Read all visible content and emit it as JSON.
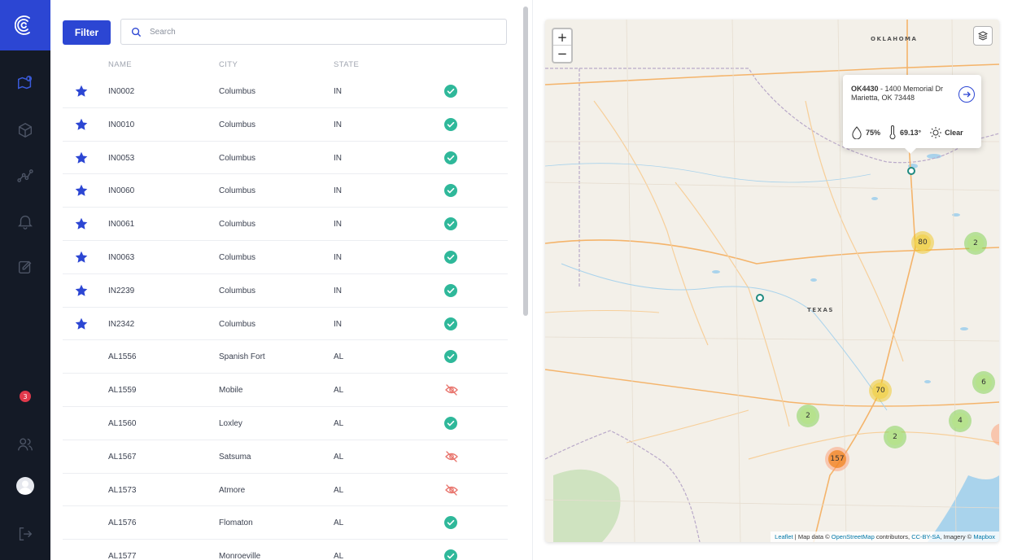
{
  "sidebar": {
    "badge_count": "3",
    "nav": [
      "logo-icon",
      "map-pin-icon",
      "cube-icon",
      "analytics-icon",
      "bell-icon",
      "clipboard-icon",
      "users-icon",
      "logout-icon"
    ]
  },
  "toolbar": {
    "filter_label": "Filter",
    "search_placeholder": "Search"
  },
  "table": {
    "headers": {
      "name": "NAME",
      "city": "CITY",
      "state": "STATE"
    },
    "rows": [
      {
        "starred": true,
        "name": "IN0002",
        "city": "Columbus",
        "state": "IN",
        "status": "ok"
      },
      {
        "starred": true,
        "name": "IN0010",
        "city": "Columbus",
        "state": "IN",
        "status": "ok"
      },
      {
        "starred": true,
        "name": "IN0053",
        "city": "Columbus",
        "state": "IN",
        "status": "ok"
      },
      {
        "starred": true,
        "name": "IN0060",
        "city": "Columbus",
        "state": "IN",
        "status": "ok"
      },
      {
        "starred": true,
        "name": "IN0061",
        "city": "Columbus",
        "state": "IN",
        "status": "ok"
      },
      {
        "starred": true,
        "name": "IN0063",
        "city": "Columbus",
        "state": "IN",
        "status": "ok"
      },
      {
        "starred": true,
        "name": "IN2239",
        "city": "Columbus",
        "state": "IN",
        "status": "ok"
      },
      {
        "starred": true,
        "name": "IN2342",
        "city": "Columbus",
        "state": "IN",
        "status": "ok"
      },
      {
        "starred": false,
        "name": "AL1556",
        "city": "Spanish Fort",
        "state": "AL",
        "status": "ok"
      },
      {
        "starred": false,
        "name": "AL1559",
        "city": "Mobile",
        "state": "AL",
        "status": "offline"
      },
      {
        "starred": false,
        "name": "AL1560",
        "city": "Loxley",
        "state": "AL",
        "status": "ok"
      },
      {
        "starred": false,
        "name": "AL1567",
        "city": "Satsuma",
        "state": "AL",
        "status": "offline"
      },
      {
        "starred": false,
        "name": "AL1573",
        "city": "Atmore",
        "state": "AL",
        "status": "offline"
      },
      {
        "starred": false,
        "name": "AL1576",
        "city": "Flomaton",
        "state": "AL",
        "status": "ok"
      },
      {
        "starred": false,
        "name": "AL1577",
        "city": "Monroeville",
        "state": "AL",
        "status": "ok"
      }
    ]
  },
  "colors": {
    "accent": "#2c46d3",
    "ok": "#2fb89a",
    "offline": "#e8736b",
    "sidebar": "#141a26"
  },
  "map": {
    "labels": {
      "oklahoma": "OKLAHOMA",
      "texas": "TEXAS"
    },
    "clusters": [
      {
        "count": "80",
        "level": "yellow"
      },
      {
        "count": "2",
        "level": "green"
      },
      {
        "count": "70",
        "level": "yellow"
      },
      {
        "count": "6",
        "level": "green"
      },
      {
        "count": "2",
        "level": "green"
      },
      {
        "count": "4",
        "level": "green"
      },
      {
        "count": "2",
        "level": "green"
      },
      {
        "count": "157",
        "level": "orange"
      }
    ],
    "popup": {
      "site_id": "OK4430",
      "address_line1": " - 1400 Memorial Dr",
      "address_line2": "Marietta, OK 73448",
      "humidity": "75%",
      "temperature": "69.13°",
      "condition": "Clear"
    },
    "attribution": {
      "leaflet": "Leaflet",
      "text1": " | Map data © ",
      "osm": "OpenStreetMap",
      "text2": " contributors, ",
      "license": "CC-BY-SA",
      "text3": ", Imagery © ",
      "mapbox": "Mapbox"
    },
    "zoom_in": "+",
    "zoom_out": "−"
  }
}
